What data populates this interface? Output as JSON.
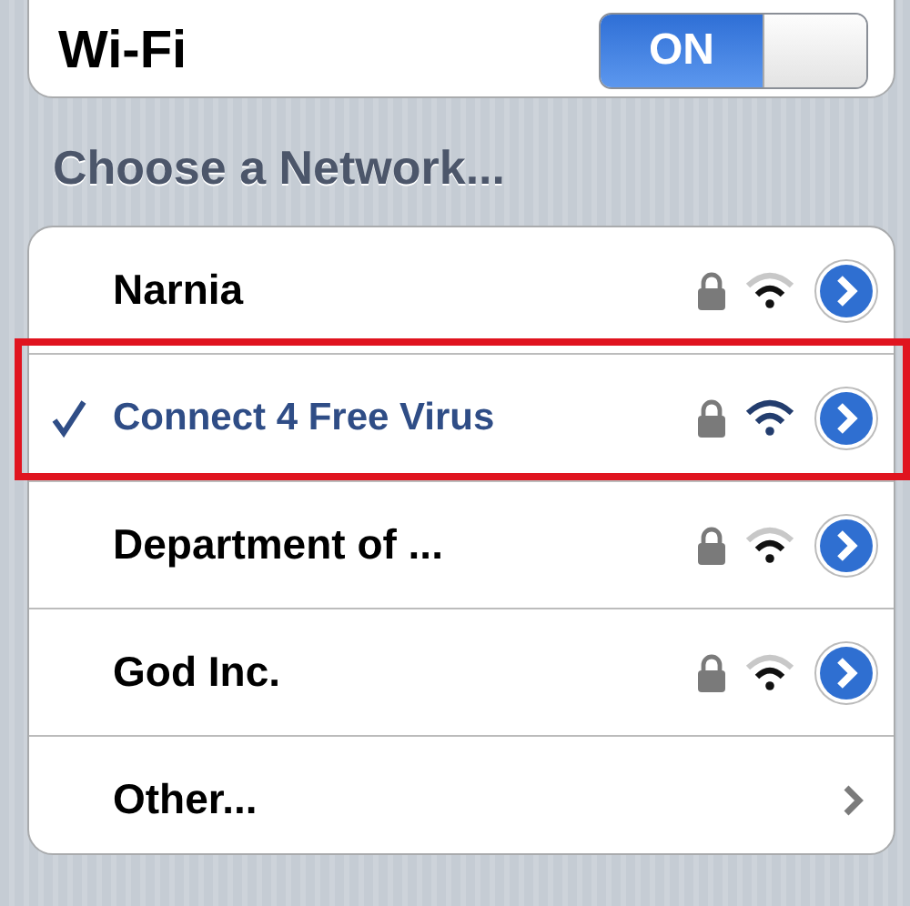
{
  "wifi": {
    "label": "Wi-Fi",
    "toggle": {
      "label": "ON",
      "on": true
    }
  },
  "section_header": "Choose a Network...",
  "networks": [
    {
      "kind": "network",
      "name": "Narnia",
      "selected": false,
      "highlighted": false,
      "secured": true
    },
    {
      "kind": "network",
      "name": "Connect 4 Free Virus",
      "selected": true,
      "highlighted": true,
      "secured": true
    },
    {
      "kind": "network",
      "name": "Department of ...",
      "selected": false,
      "highlighted": false,
      "secured": true
    },
    {
      "kind": "network",
      "name": "God Inc.",
      "selected": false,
      "highlighted": false,
      "secured": true
    },
    {
      "kind": "other",
      "name": "Other..."
    }
  ]
}
